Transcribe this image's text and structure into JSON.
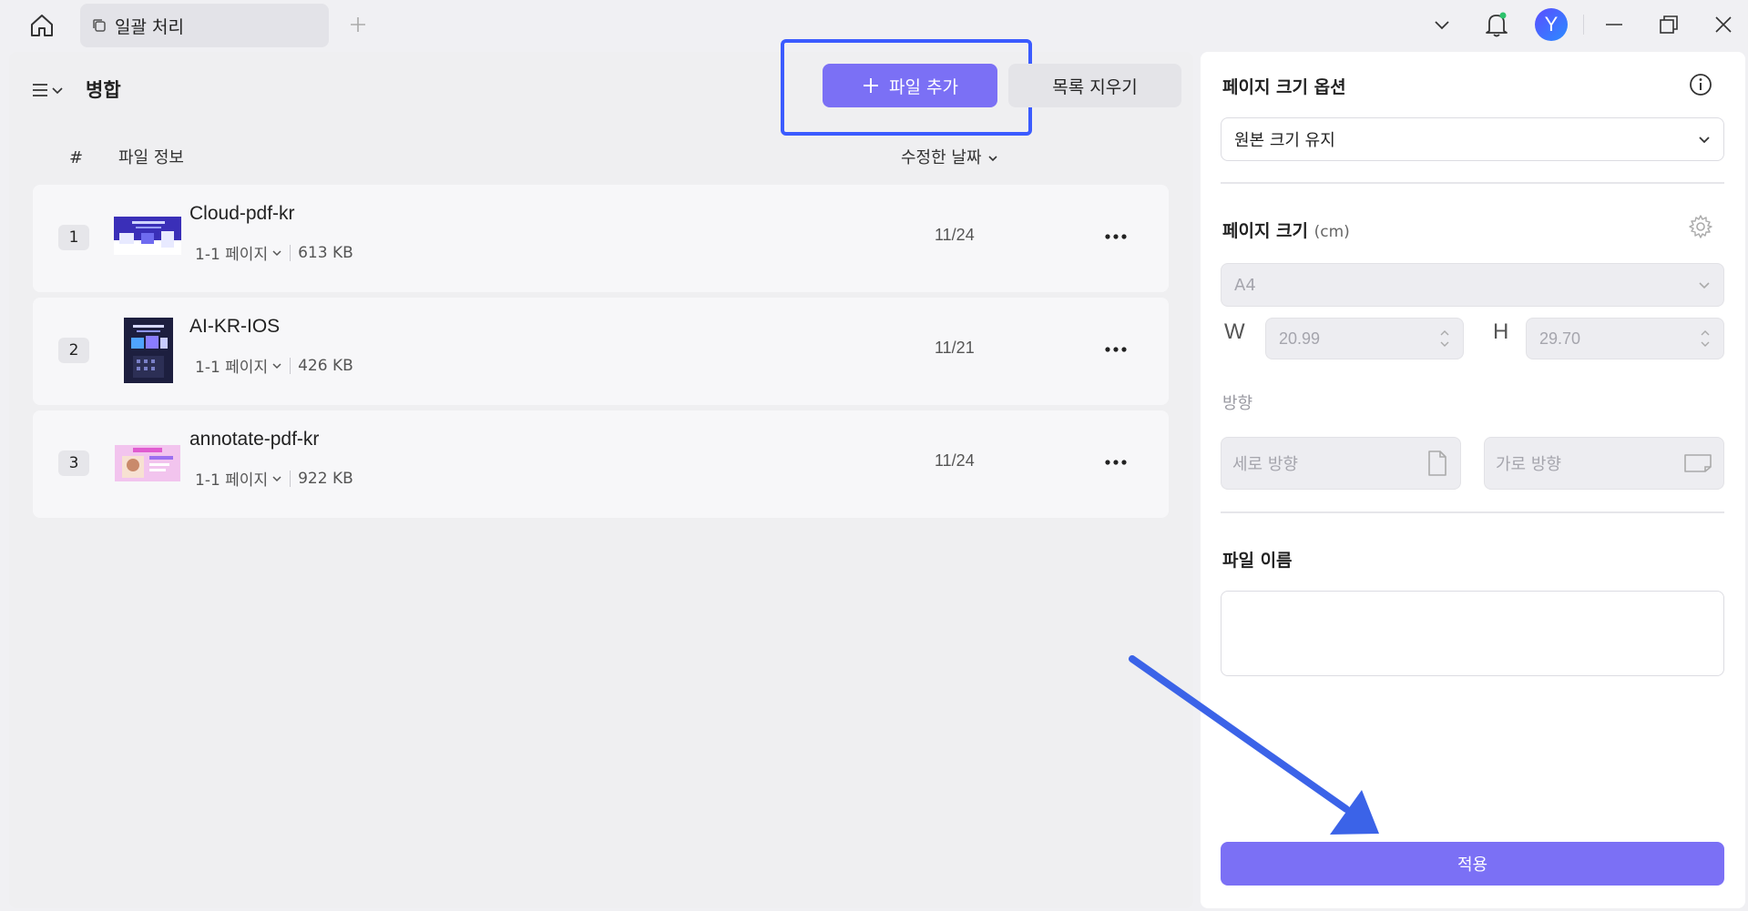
{
  "titlebar": {
    "tab_label": "일괄 처리",
    "avatar_letter": "Y",
    "icons": [
      "home-icon",
      "copy-icon",
      "plus-icon",
      "chevron-down-icon",
      "bell-icon",
      "minimize-icon",
      "restore-icon",
      "close-icon"
    ]
  },
  "left": {
    "title": "병합",
    "add_button": "파일 추가",
    "clear_button": "목록 지우기",
    "columns": {
      "num": "#",
      "info": "파일 정보",
      "date": "수정한 날짜"
    },
    "files": [
      {
        "num": "1",
        "name": "Cloud-pdf-kr",
        "pages": "1-1 페이지",
        "size": "613 KB",
        "date": "11/24"
      },
      {
        "num": "2",
        "name": "AI-KR-IOS",
        "pages": "1-1 페이지",
        "size": "426 KB",
        "date": "11/21"
      },
      {
        "num": "3",
        "name": "annotate-pdf-kr",
        "pages": "1-1 페이지",
        "size": "922 KB",
        "date": "11/24"
      }
    ]
  },
  "right": {
    "page_size_options_title": "페이지 크기 옵션",
    "page_size_option_value": "원본 크기 유지",
    "page_size_title": "페이지 크기",
    "page_size_unit": "(cm)",
    "paper_value": "A4",
    "width_label": "W",
    "width_value": "20.99",
    "height_label": "H",
    "height_value": "29.70",
    "orientation_title": "방향",
    "portrait_label": "세로 방향",
    "landscape_label": "가로 방향",
    "filename_title": "파일 이름",
    "filename_value": "",
    "apply_button": "적용"
  },
  "colors": {
    "accent": "#7b70f5",
    "highlight": "#3b5bff",
    "arrow": "#3b63e8"
  }
}
